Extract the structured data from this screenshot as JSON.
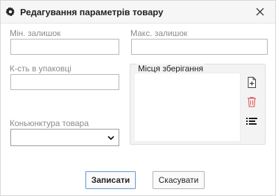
{
  "dialog": {
    "title": "Редагування параметрів товару",
    "title_icon": "gear-icon",
    "close_icon": "close-icon"
  },
  "fields": {
    "min_stock": {
      "label": "Мін. залишок",
      "value": ""
    },
    "max_stock": {
      "label": "Макс. залишок",
      "value": ""
    },
    "pack_qty": {
      "label": "К-сть в упаковці",
      "value": ""
    },
    "conjuncture": {
      "label": "Коньюнктура товара",
      "value": ""
    }
  },
  "storage": {
    "legend": "Місця зберігання",
    "items": [],
    "tools": [
      "add-document-icon",
      "delete-icon",
      "list-icon"
    ]
  },
  "colors": {
    "delete_icon": "#e05050",
    "primary_border": "#6e9fd0"
  },
  "buttons": {
    "save": "Записати",
    "cancel": "Скасувати"
  }
}
